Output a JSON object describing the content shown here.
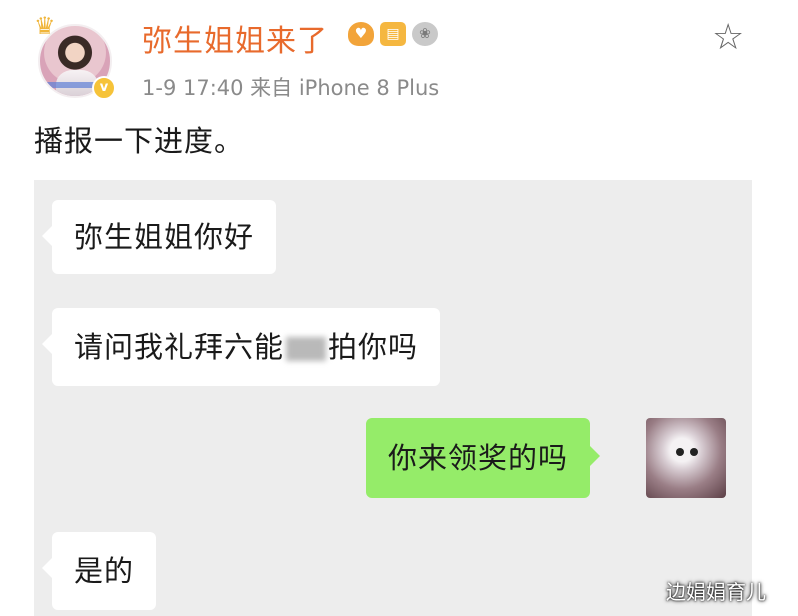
{
  "header": {
    "username": "弥生姐姐来了",
    "badges": [
      "vip-badge-icon",
      "level-badge-icon",
      "medal-badge-icon"
    ],
    "meta": "1-9 17:40  来自 iPhone 8 Plus"
  },
  "post": {
    "text": "播报一下进度。"
  },
  "chat": {
    "messages": [
      {
        "side": "left",
        "text": "弥生姐姐你好"
      },
      {
        "side": "left",
        "text_before": "请问我礼拜六能",
        "text_after": "拍你吗"
      },
      {
        "side": "right",
        "text": "你来领奖的吗"
      },
      {
        "side": "left",
        "text": "是的"
      }
    ]
  },
  "watermark": "边娟娟育儿",
  "colors": {
    "username": "#e86a2c",
    "chat_background": "#ededed",
    "sent_bubble": "#95ec69"
  }
}
